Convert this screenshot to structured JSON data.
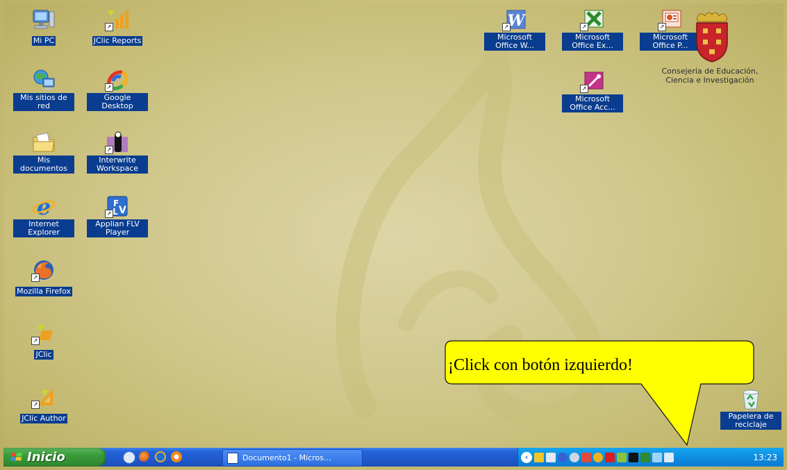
{
  "desktop": {
    "icons_left": [
      {
        "label": "Mi PC",
        "icon": "my-computer-icon"
      },
      {
        "label": "Mis sitios de red",
        "icon": "network-places-icon"
      },
      {
        "label": "Mis documentos",
        "icon": "my-documents-icon"
      },
      {
        "label": "Internet Explorer",
        "icon": "internet-explorer-icon"
      },
      {
        "label": "Mozilla Firefox",
        "icon": "firefox-icon"
      },
      {
        "label": "JClic",
        "icon": "jclic-icon"
      },
      {
        "label": "JClic Author",
        "icon": "jclic-author-icon"
      }
    ],
    "icons_col2": [
      {
        "label": "JClic Reports",
        "icon": "jclic-reports-icon"
      },
      {
        "label": "Google Desktop",
        "icon": "google-desktop-icon"
      },
      {
        "label": "Interwrite Workspace",
        "icon": "interwrite-icon"
      },
      {
        "label": "Applian FLV Player",
        "icon": "flv-player-icon"
      }
    ],
    "icons_right": [
      {
        "label": "Microsoft Office W...",
        "icon": "word-icon"
      },
      {
        "label": "Microsoft Office Ex...",
        "icon": "excel-icon"
      },
      {
        "label": "Microsoft Office P...",
        "icon": "powerpoint-icon"
      },
      {
        "label": "Microsoft Office Acc...",
        "icon": "access-icon"
      }
    ],
    "recycle_bin": {
      "label": "Papelera de reciclaje",
      "icon": "recycle-bin-icon"
    },
    "logo_text": "Consejería de Educación, Ciencia e Investigación"
  },
  "callout": {
    "text": "¡Click con botón izquierdo!",
    "color": "#ffff00"
  },
  "taskbar": {
    "start_label": "Inicio",
    "quick_launch": [
      "desktop-icon",
      "firefox-icon",
      "internet-explorer-icon",
      "media-player-icon"
    ],
    "task_button": "Documento1 - Micros...",
    "clock": "13:23",
    "colors": {
      "taskbar": "#245edc",
      "start": "#3a9b3a",
      "tray": "#0f8ce0"
    }
  }
}
